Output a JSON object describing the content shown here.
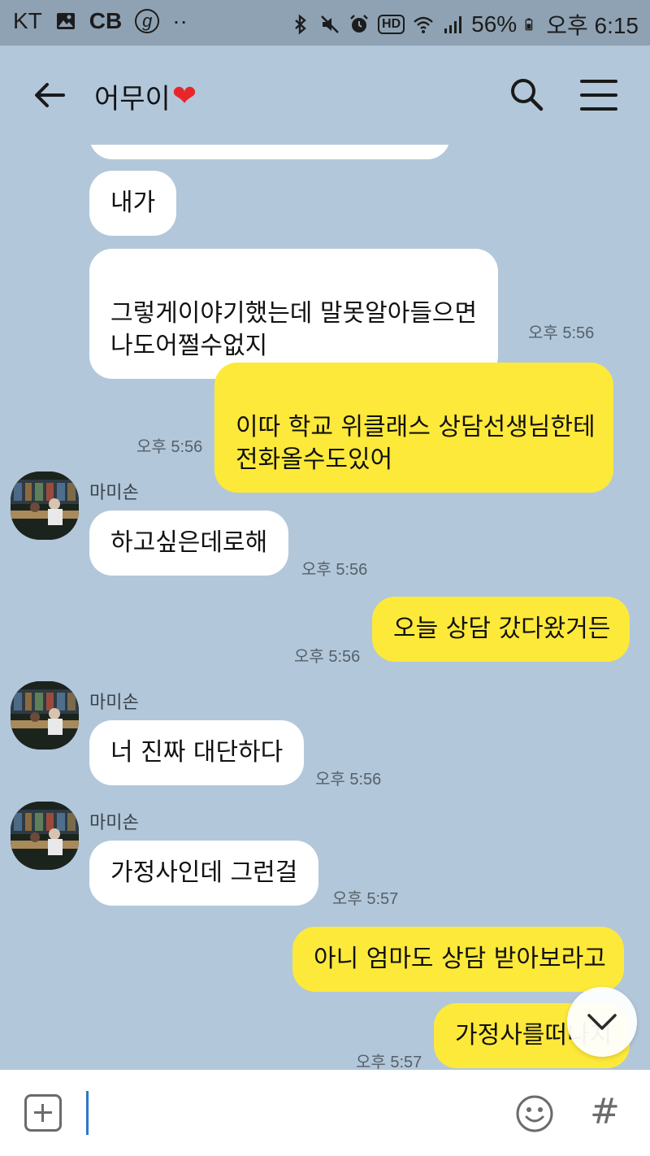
{
  "status_bar": {
    "carrier": "KT",
    "cb": "CB",
    "g_badge": "g",
    "dots": "··",
    "hd": "HD",
    "battery": "56%",
    "time": "오후 6:15"
  },
  "header": {
    "title": "어무이",
    "title_emoji": "❤"
  },
  "messages": [
    {
      "direction": "in",
      "text": ""
    },
    {
      "direction": "in",
      "text": "내가"
    },
    {
      "direction": "in",
      "text": "그렇게이야기했는데 말못알아들으면\n나도어쩔수없지",
      "time": "오후 5:56"
    },
    {
      "direction": "out",
      "text": "이따 학교 위클래스 상담선생님한테\n전화올수도있어",
      "time": "오후 5:56"
    },
    {
      "direction": "in",
      "sender": "마미손",
      "text": "하고싶은데로해",
      "time": "오후 5:56"
    },
    {
      "direction": "out",
      "text": "오늘 상담 갔다왔거든",
      "time": "오후 5:56"
    },
    {
      "direction": "in",
      "sender": "마미손",
      "text": "너 진짜 대단하다",
      "time": "오후 5:56"
    },
    {
      "direction": "in",
      "sender": "마미손",
      "text": "가정사인데 그런걸",
      "time": "오후 5:57"
    },
    {
      "direction": "out",
      "text": "아니 엄마도 상담 받아보라고"
    },
    {
      "direction": "out",
      "text": "가정사를떠나지",
      "time": "오후 5:57"
    }
  ],
  "input": {
    "placeholder": ""
  },
  "colors": {
    "background": "#b2c7da",
    "status_bar": "#8fa2b3",
    "incoming_bubble": "#ffffff",
    "outgoing_bubble": "#fde93a"
  },
  "icons": {
    "back": "arrow-left-icon",
    "search": "search-icon",
    "menu": "hamburger-menu-icon",
    "attach": "plus-icon",
    "emoji": "smiley-icon",
    "hashtag": "hash-icon",
    "scroll_down": "chevron-down-icon"
  }
}
